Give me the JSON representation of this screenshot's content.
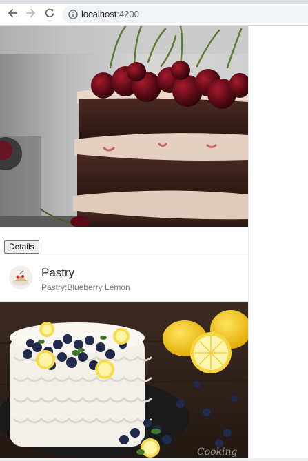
{
  "browser": {
    "url_host": "localhost",
    "url_port": ":4200",
    "back_icon": "arrow-left-icon",
    "forward_icon": "arrow-right-icon",
    "reload_icon": "reload-icon",
    "info_icon": "info-icon"
  },
  "cards": {
    "first": {
      "image": "chocolate-cherry-layer-cake-photo",
      "details_label": "Details"
    },
    "second": {
      "title": "Pastry",
      "subtitle": "Pastry:Blueberry Lemon",
      "avatar": "pastry-thumbnail",
      "image": "blueberry-lemon-cake-photo"
    }
  },
  "colors": {
    "chrome_bg": "#f1f3f4",
    "icon": "#5f6368"
  }
}
